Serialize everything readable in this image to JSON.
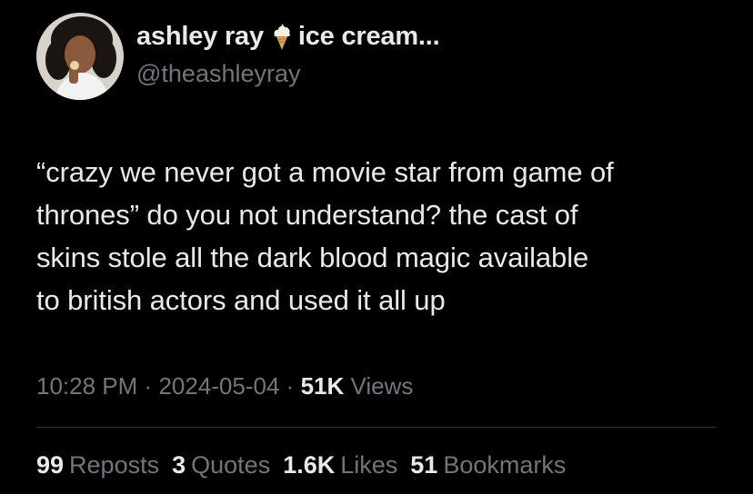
{
  "author": {
    "display_name": "ashley ray",
    "name_suffix": "ice cream...",
    "name_emoji_icon": "ice-cream-cone-icon",
    "handle": "@theashleyray"
  },
  "tweet": {
    "text_lines": [
      "“crazy we never got a movie star from game of",
      "thrones” do you not understand? the cast of",
      "skins stole all the dark blood magic available",
      "to british actors and used it all up"
    ],
    "time": "10:28 PM",
    "separator": "·",
    "date": "2024-05-04",
    "views_count": "51K",
    "views_label": "Views"
  },
  "stats": {
    "reposts_count": "99",
    "reposts_label": "Reposts",
    "quotes_count": "3",
    "quotes_label": "Quotes",
    "likes_count": "1.6K",
    "likes_label": "Likes",
    "bookmarks_count": "51",
    "bookmarks_label": "Bookmarks"
  },
  "colors": {
    "background": "#000000",
    "primary_text": "#e7e9ea",
    "secondary_text": "#71767b",
    "divider": "#2f3336"
  }
}
